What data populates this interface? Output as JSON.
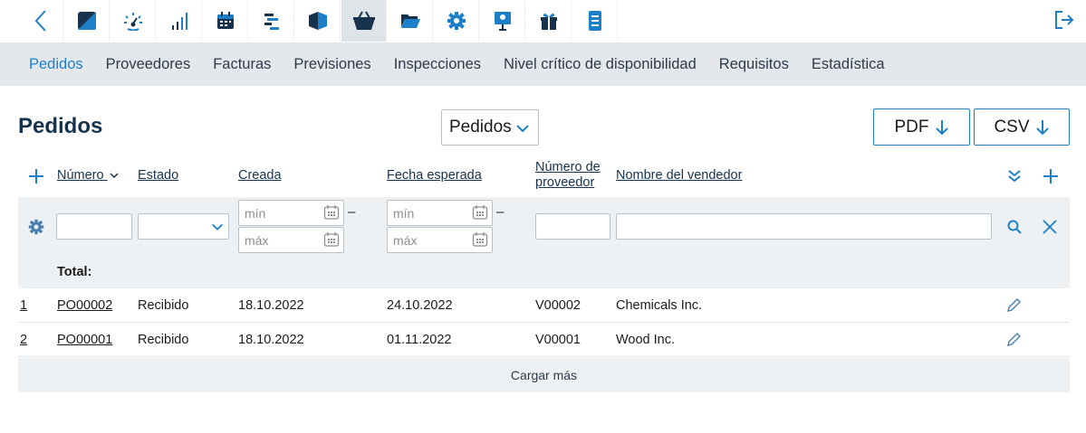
{
  "toolbar": {
    "back_icon": "chevron-left-icon",
    "apps": [
      {
        "icon": "square-diagonal-icon"
      },
      {
        "icon": "dashboard-gauge-icon"
      },
      {
        "icon": "bar-signal-icon"
      },
      {
        "icon": "calendar-icon"
      },
      {
        "icon": "gantt-list-icon"
      },
      {
        "icon": "box-icon"
      },
      {
        "icon": "basket-icon",
        "active": true
      },
      {
        "icon": "folder-open-icon"
      },
      {
        "icon": "gear-icon"
      },
      {
        "icon": "presentation-icon"
      },
      {
        "icon": "gift-icon"
      },
      {
        "icon": "document-icon"
      }
    ],
    "logout_icon": "logout-icon"
  },
  "subnav": {
    "items": [
      "Pedidos",
      "Proveedores",
      "Facturas",
      "Previsiones",
      "Inspecciones",
      "Nivel crítico de disponibilidad",
      "Requisitos",
      "Estadística"
    ],
    "active": "Pedidos"
  },
  "page": {
    "title": "Pedidos",
    "view_select": "Pedidos",
    "export_pdf": "PDF",
    "export_csv": "CSV"
  },
  "table": {
    "columns": {
      "numero": "Número",
      "estado": "Estado",
      "creada": "Creada",
      "fecha_esperada": "Fecha esperada",
      "numero_proveedor_1": "Número de",
      "numero_proveedor_2": "proveedor",
      "nombre_vendedor": "Nombre del vendedor"
    },
    "filters": {
      "min_placeholder": "mín",
      "max_placeholder": "máx",
      "range_dash": "–"
    },
    "total_label": "Total:",
    "rows": [
      {
        "index": "1",
        "numero": "PO00002",
        "estado": "Recibido",
        "creada": "18.10.2022",
        "fecha_esperada": "24.10.2022",
        "proveedor": "V00002",
        "vendedor": "Chemicals Inc."
      },
      {
        "index": "2",
        "numero": "PO00001",
        "estado": "Recibido",
        "creada": "18.10.2022",
        "fecha_esperada": "01.11.2022",
        "proveedor": "V00001",
        "vendedor": "Wood Inc."
      }
    ],
    "load_more": "Cargar más"
  },
  "colors": {
    "accent": "#1e7fc9",
    "navy": "#17324d",
    "subnav_bg": "#e4e8ec",
    "filter_bg": "#eef1f4"
  }
}
